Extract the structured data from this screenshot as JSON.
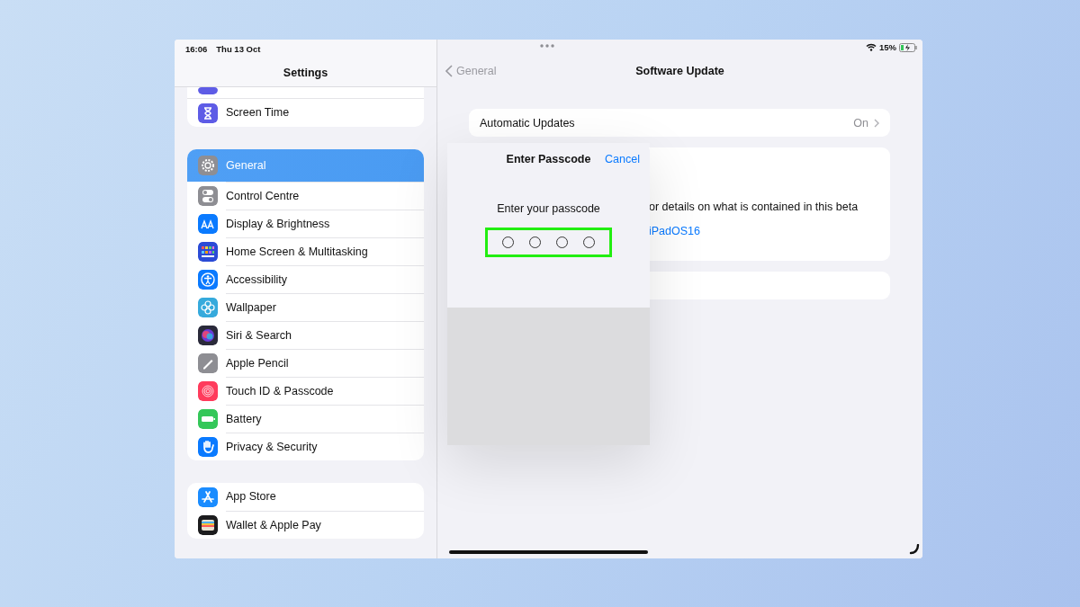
{
  "status_bar": {
    "time": "16:06",
    "date": "Thu 13 Oct",
    "battery_percent": "15%"
  },
  "sidebar": {
    "title": "Settings",
    "groups": [
      {
        "items": [
          {
            "label": "Screen Time",
            "color": "#5e5ce6",
            "selected": false
          }
        ]
      },
      {
        "items": [
          {
            "label": "General",
            "color": "#8e8e93",
            "selected": true
          },
          {
            "label": "Control Centre",
            "color": "#8e8e93",
            "selected": false
          },
          {
            "label": "Display & Brightness",
            "color": "#0a7aff",
            "selected": false
          },
          {
            "label": "Home Screen & Multitasking",
            "color": "#2b4bd6",
            "selected": false
          },
          {
            "label": "Accessibility",
            "color": "#0a7aff",
            "selected": false
          },
          {
            "label": "Wallpaper",
            "color": "#36aadc",
            "selected": false
          },
          {
            "label": "Siri & Search",
            "color": "#2a2a3a",
            "selected": false
          },
          {
            "label": "Apple Pencil",
            "color": "#8e8e93",
            "selected": false
          },
          {
            "label": "Touch ID & Passcode",
            "color": "#ff3b5c",
            "selected": false
          },
          {
            "label": "Battery",
            "color": "#34c759",
            "selected": false
          },
          {
            "label": "Privacy & Security",
            "color": "#0a7aff",
            "selected": false
          }
        ]
      },
      {
        "items": [
          {
            "label": "App Store",
            "color": "#1a8cff",
            "selected": false
          },
          {
            "label": "Wallet & Apple Pay",
            "color": "#1c1c1e",
            "selected": false
          }
        ]
      }
    ]
  },
  "detail": {
    "back": "General",
    "title": "Software Update",
    "automatic_updates": {
      "label": "Automatic Updates",
      "value": "On"
    },
    "beta_card": {
      "text": "or details on what is contained in this beta",
      "link": "iPadOS16"
    }
  },
  "passcode_sheet": {
    "title": "Enter Passcode",
    "cancel": "Cancel",
    "prompt": "Enter your passcode",
    "digits": [
      {
        "filled": false
      },
      {
        "filled": false
      },
      {
        "filled": false
      },
      {
        "filled": false
      }
    ],
    "highlighted": true
  }
}
